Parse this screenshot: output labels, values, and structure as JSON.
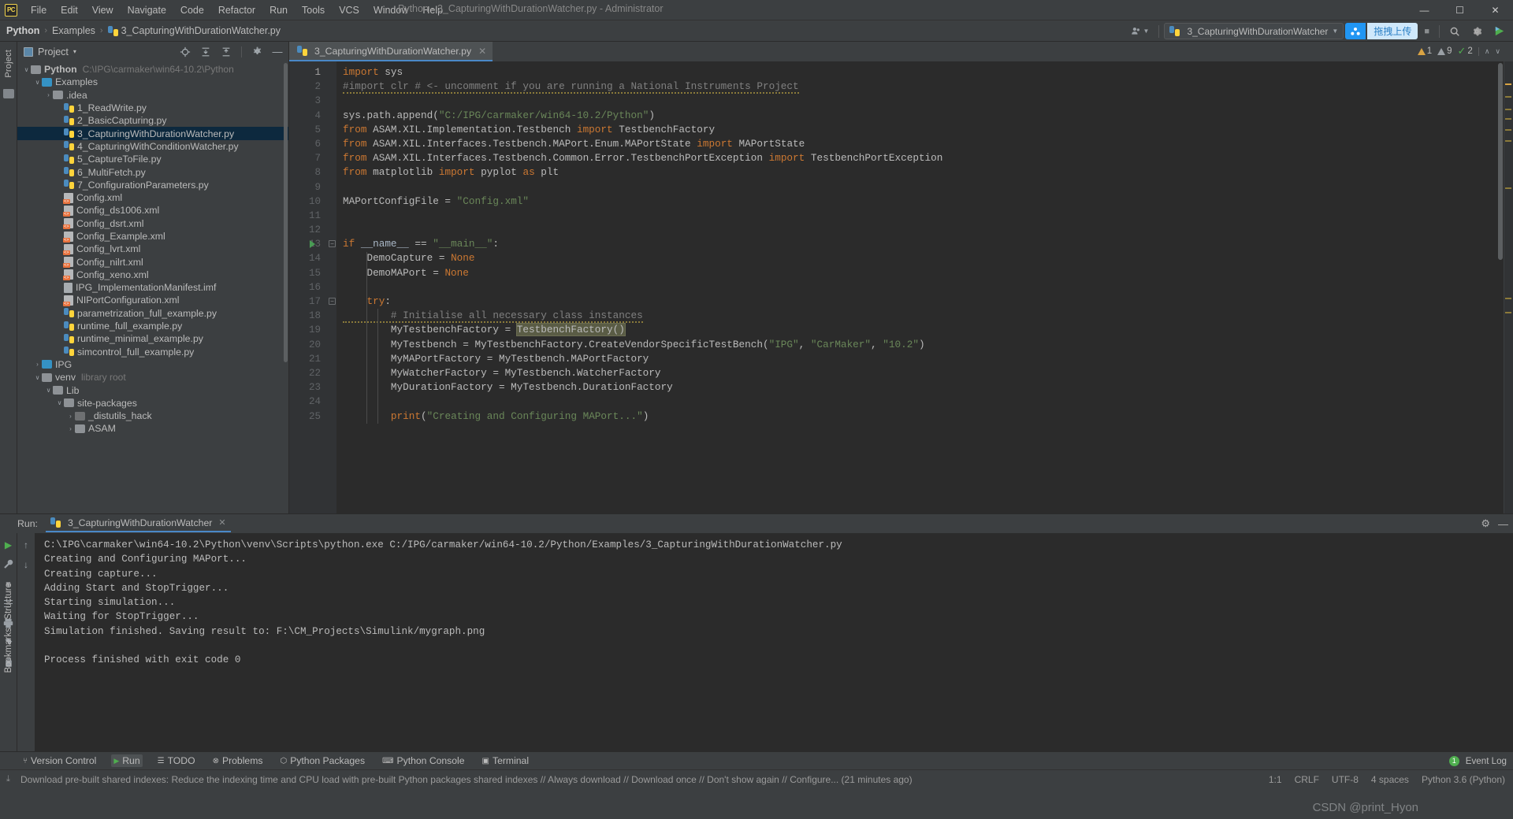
{
  "titlebar": {
    "logo": "PC",
    "menus": [
      "File",
      "Edit",
      "View",
      "Navigate",
      "Code",
      "Refactor",
      "Run",
      "Tools",
      "VCS",
      "Window",
      "Help"
    ],
    "window_title": "Python - 3_CapturingWithDurationWatcher.py - Administrator",
    "minimize": "—",
    "maximize": "☐",
    "close": "✕"
  },
  "navbar": {
    "crumbs": [
      "Python",
      "Examples",
      "3_CapturingWithDurationWatcher.py"
    ],
    "separator": "›",
    "user_icon": "user-icon",
    "run_config": "3_CapturingWithDurationWatcher",
    "cloud_badge_label": "๏",
    "cloud_label": "拖拽上传",
    "stop_label": "■",
    "search_icon": "⌕",
    "settings_icon": "⚙",
    "run_icon": "▶"
  },
  "left_strips": {
    "project_label": "Project",
    "structure_label": "Structure",
    "bookmarks_label": "Bookmarks"
  },
  "project_panel": {
    "title": "Project",
    "caret": "▾",
    "icons": [
      "locate-icon",
      "expand-all-icon",
      "collapse-all-icon",
      "settings-icon",
      "hide-icon"
    ],
    "tree": [
      {
        "indent": 0,
        "arrow": "∨",
        "icon": "folder-grey",
        "label": "Python",
        "bold": true,
        "muted": "C:\\IPG\\carmaker\\win64-10.2\\Python"
      },
      {
        "indent": 1,
        "arrow": "∨",
        "icon": "folder-blue",
        "label": "Examples",
        "bold": false,
        "muted": ""
      },
      {
        "indent": 2,
        "arrow": "›",
        "icon": "folder-grey",
        "label": ".idea",
        "bold": false,
        "muted": ""
      },
      {
        "indent": 3,
        "arrow": "",
        "icon": "py",
        "label": "1_ReadWrite.py",
        "bold": false,
        "muted": ""
      },
      {
        "indent": 3,
        "arrow": "",
        "icon": "py",
        "label": "2_BasicCapturing.py",
        "bold": false,
        "muted": ""
      },
      {
        "indent": 3,
        "arrow": "",
        "icon": "py",
        "label": "3_CapturingWithDurationWatcher.py",
        "bold": false,
        "muted": "",
        "selected": true
      },
      {
        "indent": 3,
        "arrow": "",
        "icon": "py",
        "label": "4_CapturingWithConditionWatcher.py",
        "bold": false,
        "muted": ""
      },
      {
        "indent": 3,
        "arrow": "",
        "icon": "py",
        "label": "5_CaptureToFile.py",
        "bold": false,
        "muted": ""
      },
      {
        "indent": 3,
        "arrow": "",
        "icon": "py",
        "label": "6_MultiFetch.py",
        "bold": false,
        "muted": ""
      },
      {
        "indent": 3,
        "arrow": "",
        "icon": "py",
        "label": "7_ConfigurationParameters.py",
        "bold": false,
        "muted": ""
      },
      {
        "indent": 3,
        "arrow": "",
        "icon": "xml",
        "label": "Config.xml",
        "bold": false,
        "muted": ""
      },
      {
        "indent": 3,
        "arrow": "",
        "icon": "xml",
        "label": "Config_ds1006.xml",
        "bold": false,
        "muted": ""
      },
      {
        "indent": 3,
        "arrow": "",
        "icon": "xml",
        "label": "Config_dsrt.xml",
        "bold": false,
        "muted": ""
      },
      {
        "indent": 3,
        "arrow": "",
        "icon": "xml",
        "label": "Config_Example.xml",
        "bold": false,
        "muted": ""
      },
      {
        "indent": 3,
        "arrow": "",
        "icon": "xml",
        "label": "Config_lvrt.xml",
        "bold": false,
        "muted": ""
      },
      {
        "indent": 3,
        "arrow": "",
        "icon": "xml",
        "label": "Config_nilrt.xml",
        "bold": false,
        "muted": ""
      },
      {
        "indent": 3,
        "arrow": "",
        "icon": "xml",
        "label": "Config_xeno.xml",
        "bold": false,
        "muted": ""
      },
      {
        "indent": 3,
        "arrow": "",
        "icon": "imf",
        "label": "IPG_ImplementationManifest.imf",
        "bold": false,
        "muted": ""
      },
      {
        "indent": 3,
        "arrow": "",
        "icon": "xml",
        "label": "NIPortConfiguration.xml",
        "bold": false,
        "muted": ""
      },
      {
        "indent": 3,
        "arrow": "",
        "icon": "py",
        "label": "parametrization_full_example.py",
        "bold": false,
        "muted": ""
      },
      {
        "indent": 3,
        "arrow": "",
        "icon": "py",
        "label": "runtime_full_example.py",
        "bold": false,
        "muted": ""
      },
      {
        "indent": 3,
        "arrow": "",
        "icon": "py",
        "label": "runtime_minimal_example.py",
        "bold": false,
        "muted": ""
      },
      {
        "indent": 3,
        "arrow": "",
        "icon": "py",
        "label": "simcontrol_full_example.py",
        "bold": false,
        "muted": ""
      },
      {
        "indent": 1,
        "arrow": "›",
        "icon": "folder-blue",
        "label": "IPG",
        "bold": false,
        "muted": ""
      },
      {
        "indent": 1,
        "arrow": "∨",
        "icon": "folder-grey",
        "label": "venv",
        "bold": false,
        "muted": "library root"
      },
      {
        "indent": 2,
        "arrow": "∨",
        "icon": "folder-grey",
        "label": "Lib",
        "bold": false,
        "muted": ""
      },
      {
        "indent": 3,
        "arrow": "∨",
        "icon": "folder-grey",
        "label": "site-packages",
        "bold": false,
        "muted": ""
      },
      {
        "indent": 4,
        "arrow": "›",
        "icon": "folder-dark",
        "label": "_distutils_hack",
        "bold": false,
        "muted": ""
      },
      {
        "indent": 4,
        "arrow": "›",
        "icon": "folder-grey",
        "label": "ASAM",
        "bold": false,
        "muted": ""
      }
    ]
  },
  "editor": {
    "tab_label": "3_CapturingWithDurationWatcher.py",
    "tab_close": "✕",
    "first_line": 1,
    "lines": [
      {
        "n": 1,
        "text": "import sys"
      },
      {
        "n": 2,
        "text": "#import clr # <- uncomment if you are running a National Instruments Project"
      },
      {
        "n": 3,
        "text": ""
      },
      {
        "n": 4,
        "text": "sys.path.append(\"C:/IPG/carmaker/win64-10.2/Python\")"
      },
      {
        "n": 5,
        "text": "from ASAM.XIL.Implementation.Testbench import TestbenchFactory"
      },
      {
        "n": 6,
        "text": "from ASAM.XIL.Interfaces.Testbench.MAPort.Enum.MAPortState import MAPortState"
      },
      {
        "n": 7,
        "text": "from ASAM.XIL.Interfaces.Testbench.Common.Error.TestbenchPortException import TestbenchPortException"
      },
      {
        "n": 8,
        "text": "from matplotlib import pyplot as plt"
      },
      {
        "n": 9,
        "text": ""
      },
      {
        "n": 10,
        "text": "MAPortConfigFile = \"Config.xml\""
      },
      {
        "n": 11,
        "text": ""
      },
      {
        "n": 12,
        "text": ""
      },
      {
        "n": 13,
        "text": "if __name__ == \"__main__\":"
      },
      {
        "n": 14,
        "text": "    DemoCapture = None"
      },
      {
        "n": 15,
        "text": "    DemoMAPort = None"
      },
      {
        "n": 16,
        "text": ""
      },
      {
        "n": 17,
        "text": "    try:"
      },
      {
        "n": 18,
        "text": "        # Initialise all necessary class instances"
      },
      {
        "n": 19,
        "text": "        MyTestbenchFactory = TestbenchFactory()"
      },
      {
        "n": 20,
        "text": "        MyTestbench = MyTestbenchFactory.CreateVendorSpecificTestBench(\"IPG\", \"CarMaker\", \"10.2\")"
      },
      {
        "n": 21,
        "text": "        MyMAPortFactory = MyTestbench.MAPortFactory"
      },
      {
        "n": 22,
        "text": "        MyWatcherFactory = MyTestbench.WatcherFactory"
      },
      {
        "n": 23,
        "text": "        MyDurationFactory = MyTestbench.DurationFactory"
      },
      {
        "n": 24,
        "text": ""
      },
      {
        "n": 25,
        "text": "        print(\"Creating and Configuring MAPort...\")"
      }
    ],
    "selection_text": "TestbenchFactory()",
    "inspection": {
      "warnings_count": "1",
      "weak_warnings_count": "9",
      "typos_count": "2",
      "ok_mark": "✓",
      "chevron_up": "∧",
      "chevron_down": "∨"
    }
  },
  "run_window": {
    "title": "Run:",
    "tab_label": "3_CapturingWithDurationWatcher",
    "tab_close": "✕",
    "settings_icon": "⚙",
    "hide_icon": "—",
    "side_buttons": [
      "rerun-icon",
      "up-icon",
      "wrench-icon",
      "down-icon",
      "stop-icon",
      "soft-wrap-icon",
      "print-icon",
      "scroll-icon",
      "pin-icon",
      "trash-icon"
    ],
    "console_lines": [
      "C:\\IPG\\carmaker\\win64-10.2\\Python\\venv\\Scripts\\python.exe C:/IPG/carmaker/win64-10.2/Python/Examples/3_CapturingWithDurationWatcher.py",
      "Creating and Configuring MAPort...",
      "Creating capture...",
      "Adding Start and StopTrigger...",
      "Starting simulation...",
      "Waiting for StopTrigger...",
      "Simulation finished. Saving result to: F:\\CM_Projects\\Simulink/mygraph.png",
      "",
      "Process finished with exit code 0"
    ]
  },
  "bottom_toolbar": {
    "items": [
      {
        "icon": "version-control-icon",
        "label": "Version Control",
        "active": false
      },
      {
        "icon": "run-icon",
        "label": "Run",
        "active": true
      },
      {
        "icon": "todo-icon",
        "label": "TODO",
        "active": false
      },
      {
        "icon": "problems-icon",
        "label": "Problems",
        "active": false
      },
      {
        "icon": "python-packages-icon",
        "label": "Python Packages",
        "active": false
      },
      {
        "icon": "python-console-icon",
        "label": "Python Console",
        "active": false
      },
      {
        "icon": "terminal-icon",
        "label": "Terminal",
        "active": false
      }
    ],
    "event_log": "Event Log",
    "event_count": "1"
  },
  "statusbar": {
    "message": "Download pre-built shared indexes: Reduce the indexing time and CPU load with pre-built Python packages shared indexes // Always download // Download once // Don't show again // Configure... (21 minutes ago)",
    "download_icon": "⤓",
    "caret_position": "1:1",
    "line_separator": "CRLF",
    "encoding": "UTF-8",
    "indent": "4 spaces",
    "interpreter": "Python 3.6 (Python)",
    "watermark": "CSDN @print_Hyon"
  },
  "colors": {
    "background": "#3c3f41",
    "editor_bg": "#2b2b2b",
    "accent_blue": "#4a88c7",
    "selection_blue": "#0d293e",
    "keyword_orange": "#cc7832",
    "string_green": "#6a8759",
    "comment_grey": "#808080",
    "cloud_blue": "#2196f3"
  }
}
